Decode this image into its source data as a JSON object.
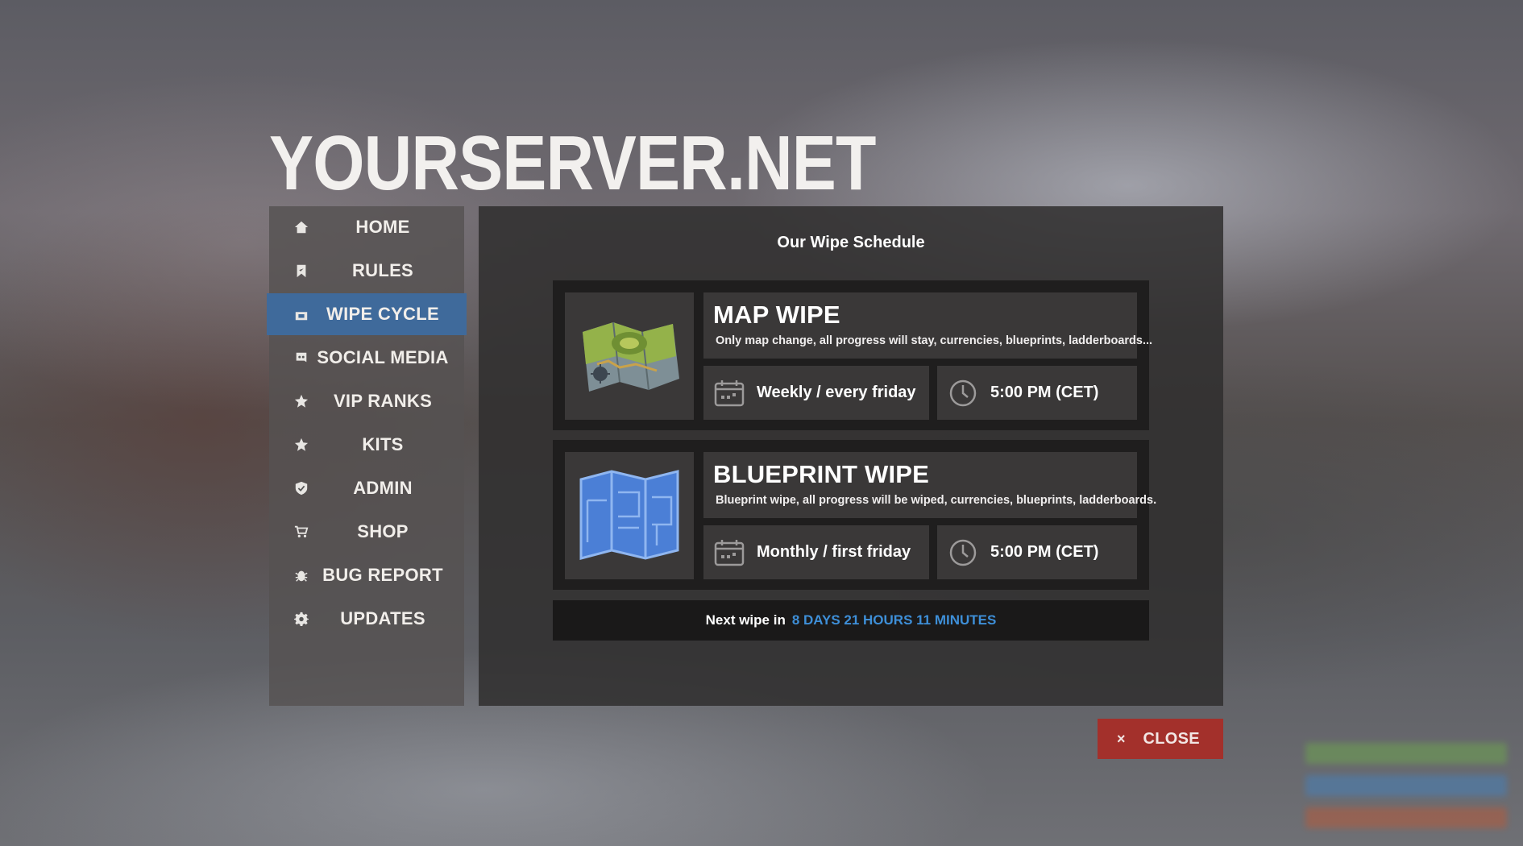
{
  "server_title": "YOURSERVER.NET",
  "nav": {
    "items": [
      {
        "label": "HOME",
        "icon": "home-icon"
      },
      {
        "label": "RULES",
        "icon": "bookmark-icon"
      },
      {
        "label": "WIPE CYCLE",
        "icon": "calendar-icon",
        "active": true
      },
      {
        "label": "SOCIAL MEDIA",
        "icon": "discord-icon"
      },
      {
        "label": "VIP RANKS",
        "icon": "star-icon"
      },
      {
        "label": "KITS",
        "icon": "star-icon"
      },
      {
        "label": "ADMIN",
        "icon": "shield-icon"
      },
      {
        "label": "SHOP",
        "icon": "cart-icon"
      },
      {
        "label": "BUG REPORT",
        "icon": "bug-icon"
      },
      {
        "label": "UPDATES",
        "icon": "gear-icon"
      }
    ],
    "active_color": "#3f6a9b"
  },
  "main": {
    "title": "Our Wipe Schedule",
    "wipes": [
      {
        "title": "MAP WIPE",
        "description": "Only map change, all progress will stay, currencies, blueprints, ladderboards...",
        "icon": "map-icon",
        "schedule": "Weekly / every friday",
        "time": "5:00 PM (CET)"
      },
      {
        "title": "BLUEPRINT WIPE",
        "description": "Blueprint wipe, all progress will be wiped, currencies, blueprints, ladderboards.",
        "icon": "blueprint-icon",
        "schedule": "Monthly / first friday",
        "time": "5:00 PM (CET)"
      }
    ],
    "next_wipe": {
      "label": "Next wipe in",
      "value": "8 DAYS 21 HOURS 11 MINUTES",
      "value_color": "#3e8fd8"
    }
  },
  "close_button": {
    "icon": "×",
    "label": "CLOSE",
    "color": "#a3302b"
  }
}
